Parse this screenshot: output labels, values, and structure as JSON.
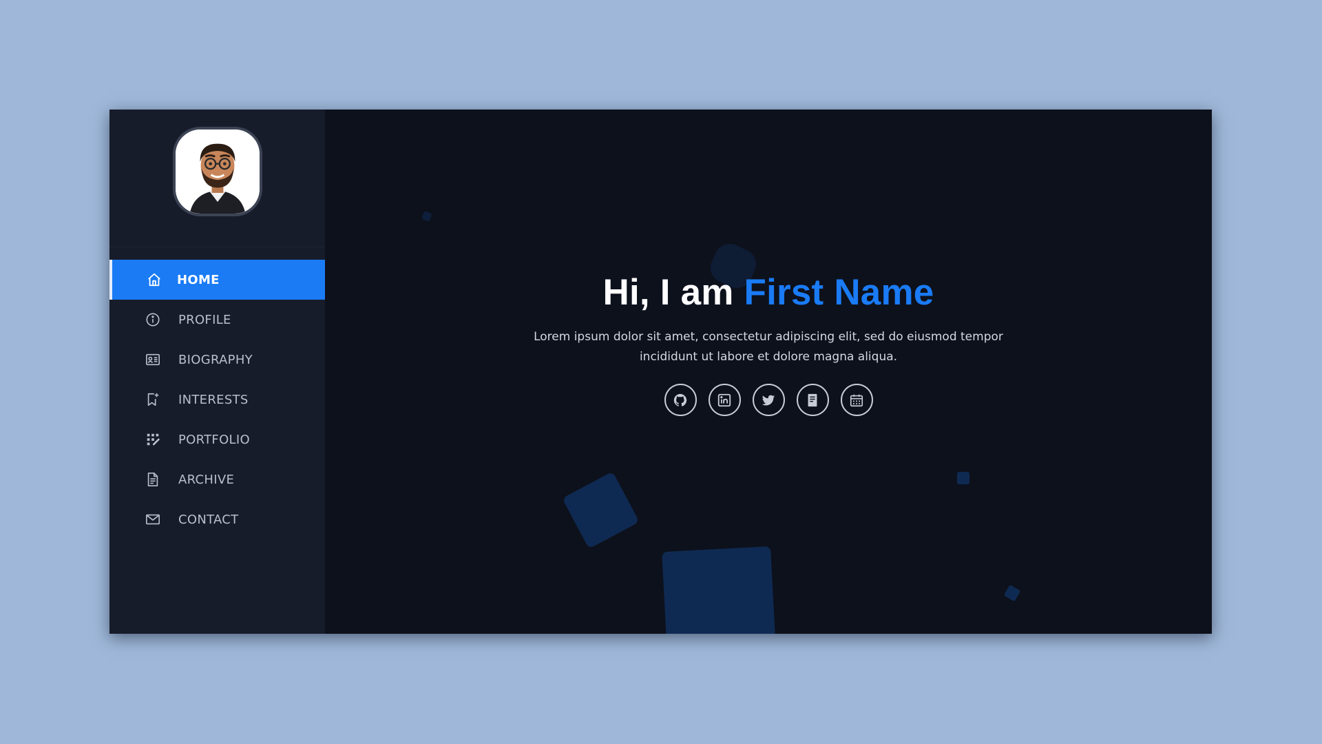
{
  "nav": {
    "items": [
      {
        "label": "HOME",
        "icon": "home-icon",
        "active": true
      },
      {
        "label": "PROFILE",
        "icon": "info-icon"
      },
      {
        "label": "BIOGRAPHY",
        "icon": "id-card-icon"
      },
      {
        "label": "INTERESTS",
        "icon": "bookmark-plus-icon"
      },
      {
        "label": "PORTFOLIO",
        "icon": "grid-pencil-icon"
      },
      {
        "label": "ARCHIVE",
        "icon": "document-icon"
      },
      {
        "label": "CONTACT",
        "icon": "envelope-icon"
      }
    ]
  },
  "hero": {
    "greeting": "Hi, I am ",
    "name": "First Name",
    "description": "Lorem ipsum dolor sit amet, consectetur adipiscing elit, sed do eiusmod tempor incididunt ut labore et dolore magna aliqua."
  },
  "social": [
    {
      "icon": "github-icon"
    },
    {
      "icon": "linkedin-icon"
    },
    {
      "icon": "twitter-icon"
    },
    {
      "icon": "resume-icon"
    },
    {
      "icon": "calendar-icon"
    }
  ],
  "colors": {
    "page_background": "#9fb8d9",
    "sidebar": "#171c2b",
    "main": "#0d111c",
    "accent": "#1a7bf5"
  }
}
